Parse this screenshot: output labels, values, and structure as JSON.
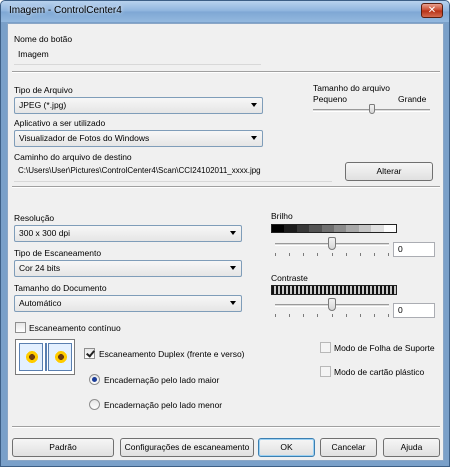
{
  "window": {
    "title": "Imagem - ControlCenter4",
    "close_glyph": "✕"
  },
  "button_name": {
    "label": "Nome do botão",
    "value": "Imagem"
  },
  "file_type": {
    "label": "Tipo de Arquivo",
    "value": "JPEG (*.jpg)"
  },
  "file_size": {
    "label": "Tamanho do arquivo",
    "min_label": "Pequeno",
    "max_label": "Grande",
    "level": 0.5
  },
  "application": {
    "label": "Aplicativo a ser utilizado",
    "value": "Visualizador de Fotos do Windows"
  },
  "destination": {
    "label": "Caminho do arquivo de destino",
    "value": "C:\\Users\\User\\Pictures\\ControlCenter4\\Scan\\CCI24102011_xxxx.jpg",
    "change_button": "Alterar"
  },
  "resolution": {
    "label": "Resolução",
    "value": "300 x 300 dpi"
  },
  "scan_type": {
    "label": "Tipo de Escaneamento",
    "value": "Cor 24 bits"
  },
  "document_size": {
    "label": "Tamanho do Documento",
    "value": "Automático"
  },
  "brightness": {
    "label": "Brilho",
    "value": "0",
    "level": 0.5
  },
  "contrast": {
    "label": "Contraste",
    "value": "0",
    "level": 0.5
  },
  "continuous_scan": {
    "label": "Escaneamento contínuo",
    "checked": false
  },
  "duplex": {
    "icon": "duplex-book-icon",
    "label": "Escaneamento Duplex (frente e verso)",
    "checked": true,
    "long_edge": "Encadernação pelo lado maior",
    "short_edge": "Encadernação pelo lado menor",
    "selected": "long_edge"
  },
  "carrier_sheet": {
    "label": "Modo de Folha de Suporte",
    "checked": false
  },
  "plastic_card": {
    "label": "Modo de cartão plástico",
    "checked": false
  },
  "footer": {
    "default_button": "Padrão",
    "scan_settings_button": "Configurações de escaneamento",
    "ok_button": "OK",
    "cancel_button": "Cancelar",
    "help_button": "Ajuda"
  },
  "colors": {
    "title_bar": "#8db3dd",
    "close_button": "#c8462a",
    "radio_dot": "#1b3d99"
  }
}
